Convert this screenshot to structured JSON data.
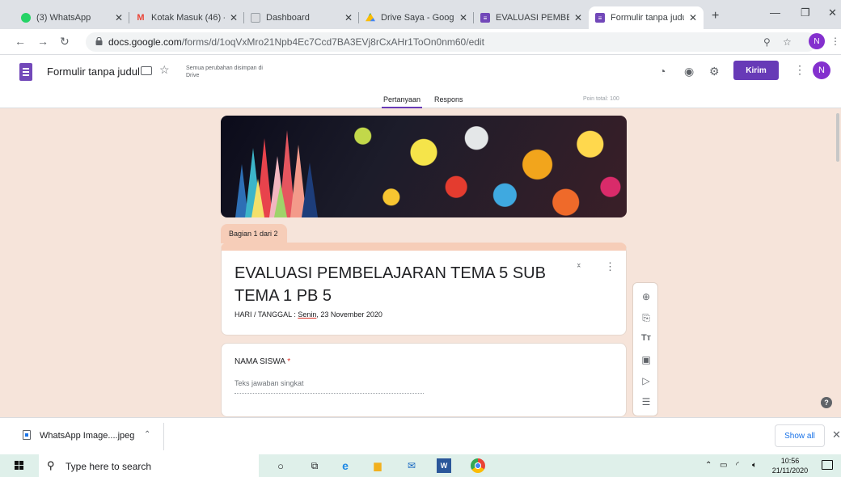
{
  "browser": {
    "tabs": [
      {
        "title": "(3) WhatsApp",
        "icon": "whatsapp-icon",
        "color": "#25d366"
      },
      {
        "title": "Kotak Masuk (46) - n",
        "icon": "gmail-icon",
        "color": "#ea4335"
      },
      {
        "title": "Dashboard",
        "icon": "classroom-icon",
        "color": "#9aa0a6"
      },
      {
        "title": "Drive Saya - Google",
        "icon": "drive-icon",
        "color": "#fbbc04"
      },
      {
        "title": "EVALUASI PEMBELAJ",
        "icon": "forms-icon",
        "color": "#7248b9"
      },
      {
        "title": "Formulir tanpa judul",
        "icon": "forms-icon",
        "color": "#7248b9"
      }
    ],
    "url_host": "docs.google.com",
    "url_path": "/forms/d/1oqVxMro21Npb4Ec7Ccd7BA3EVj8rCxAHr1ToOn0nm60/edit",
    "avatar_letter": "N"
  },
  "form_header": {
    "doc_title": "Formulir tanpa judul",
    "saved_status": "Semua perubahan disimpan di Drive",
    "send_label": "Kirim",
    "avatar_letter": "N",
    "tabs": [
      "Pertanyaan",
      "Respons"
    ],
    "points_label": "Poin total: 100"
  },
  "form": {
    "section_label": "Bagian 1 dari 2",
    "title": "EVALUASI PEMBELAJARAN TEMA 5 SUB TEMA 1 PB 5",
    "desc_prefix": "HARI / TANGGAL : ",
    "desc_day": "Senin",
    "desc_suffix": ", 23 November 2020",
    "question": {
      "label": "NAMA SISWA",
      "required_mark": "*",
      "placeholder": "Teks jawaban singkat"
    },
    "toolbar": [
      "add-question-icon",
      "import-questions-icon",
      "add-title-icon",
      "add-image-icon",
      "add-video-icon",
      "add-section-icon"
    ],
    "toolbar_title_glyph": "Tт"
  },
  "download_bar": {
    "file_name": "WhatsApp Image....jpeg",
    "show_all_label": "Show all"
  },
  "taskbar": {
    "search_placeholder": "Type here to search",
    "time": "10:56",
    "date": "21/11/2020"
  },
  "colors": {
    "accent": "#673ab7",
    "page_bg": "#f6e4da",
    "section_accent": "#f6cdb8",
    "required": "#d93025"
  }
}
